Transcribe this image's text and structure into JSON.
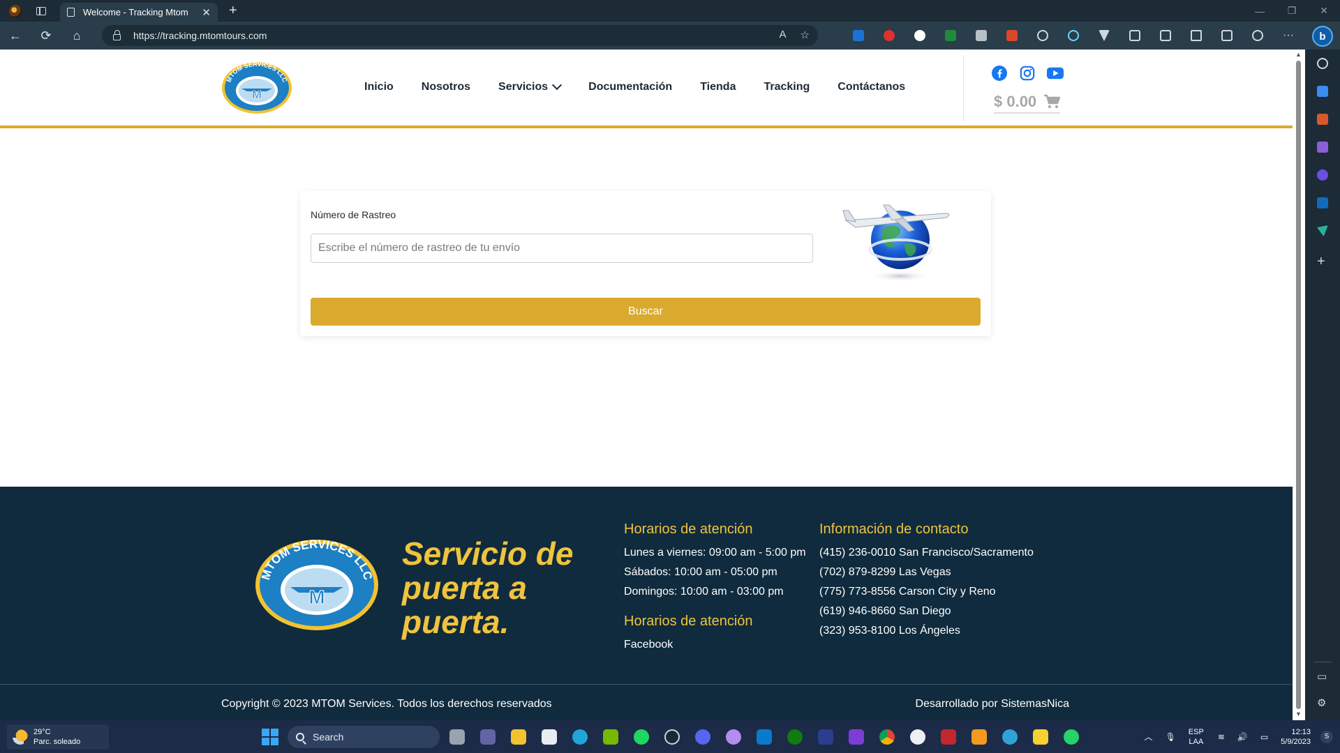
{
  "browser": {
    "tab_title": "Welcome - Tracking Mtom",
    "url": "https://tracking.mtomtours.com"
  },
  "site": {
    "nav": [
      {
        "label": "Inicio"
      },
      {
        "label": "Nosotros"
      },
      {
        "label": "Servicios",
        "has_dropdown": true
      },
      {
        "label": "Documentación"
      },
      {
        "label": "Tienda"
      },
      {
        "label": "Tracking"
      },
      {
        "label": "Contáctanos"
      }
    ],
    "social": [
      "facebook-icon",
      "instagram-icon",
      "youtube-icon"
    ],
    "cart_total": "$ 0.00",
    "logo_text": "MTOM SERVICES LLC",
    "logo_letter": "M"
  },
  "tracking": {
    "label": "Número de Rastreo",
    "placeholder": "Escribe el número de rastreo de tu envío",
    "button": "Buscar"
  },
  "footer": {
    "slogan": "Servicio de puerta a puerta.",
    "hours_title": "Horarios de atención",
    "hours": [
      "Lunes a viernes: 09:00 am - 5:00 pm",
      "Sábados: 10:00 am - 05:00 pm",
      "Domingos: 10:00 am - 03:00 pm"
    ],
    "hours_title_2": "Horarios de atención",
    "social_link": "Facebook",
    "contact_title": "Información de contacto",
    "contacts": [
      "(415) 236-0010 San Francisco/Sacramento",
      "(702) 879-8299 Las Vegas",
      "(775) 773-8556 Carson City y Reno",
      "(619) 946-8660 San Diego",
      "(323) 953-8100 Los Ángeles"
    ],
    "copyright": "Copyright © 2023 MTOM Services. Todos los derechos reservados",
    "developer": "Desarrollado por SistemasNica"
  },
  "taskbar": {
    "weather_temp": "29°C",
    "weather_desc": "Parc. soleado",
    "search_label": "Search",
    "lang_1": "ESP",
    "lang_2": "LAA",
    "time": "12:13",
    "date": "5/9/2023"
  },
  "colors": {
    "gold": "#d9aa2d",
    "footer_bg": "#0f2b3d",
    "nav_text": "#1e2a36",
    "facebook": "#1877f2"
  }
}
